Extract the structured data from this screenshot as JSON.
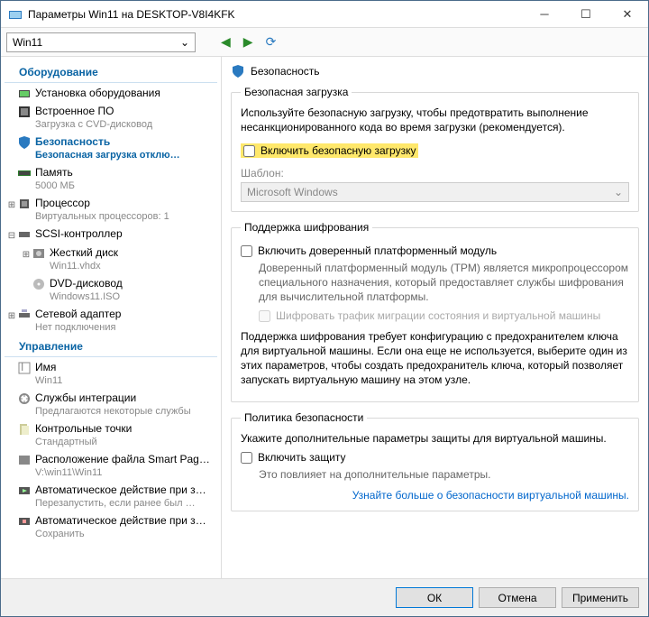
{
  "window": {
    "title": "Параметры Win11 на DESKTOP-V8I4KFK",
    "vm_name": "Win11"
  },
  "sidebar": {
    "cat_hardware": "Оборудование",
    "cat_management": "Управление",
    "items": {
      "add_hw": {
        "label": "Установка оборудования"
      },
      "firmware": {
        "label": "Встроенное ПО",
        "sub": "Загрузка с CVD-дисковод"
      },
      "security": {
        "label": "Безопасность",
        "sub": "Безопасная загрузка отклю…"
      },
      "memory": {
        "label": "Память",
        "sub": "5000 МБ"
      },
      "cpu": {
        "label": "Процессор",
        "sub": "Виртуальных процессоров: 1"
      },
      "scsi": {
        "label": "SCSI-контроллер"
      },
      "hdd": {
        "label": "Жесткий диск",
        "sub": "Win11.vhdx"
      },
      "dvd": {
        "label": "DVD-дисковод",
        "sub": "Windows11.ISO"
      },
      "net": {
        "label": "Сетевой адаптер",
        "sub": "Нет подключения"
      },
      "name": {
        "label": "Имя",
        "sub": "Win11"
      },
      "integ": {
        "label": "Службы интеграции",
        "sub": "Предлагаются некоторые службы"
      },
      "checkpoints": {
        "label": "Контрольные точки",
        "sub": "Стандартный"
      },
      "paging": {
        "label": "Расположение файла Smart Paging",
        "sub": "V:\\win11\\Win11"
      },
      "auto_start": {
        "label": "Автоматическое действие при за…",
        "sub": "Перезапустить, если ранее был …"
      },
      "auto_stop": {
        "label": "Автоматическое действие при за…",
        "sub": "Сохранить"
      }
    }
  },
  "panel": {
    "title": "Безопасность",
    "secure_boot": {
      "legend": "Безопасная загрузка",
      "desc": "Используйте безопасную загрузку, чтобы предотвратить выполнение несанкционированного кода во время загрузки (рекомендуется).",
      "enable": "Включить безопасную загрузку",
      "template_label": "Шаблон:",
      "template_value": "Microsoft Windows"
    },
    "encryption": {
      "legend": "Поддержка шифрования",
      "tpm": "Включить доверенный платформенный модуль",
      "tpm_desc": "Доверенный платформенный модуль (TPM) является микропроцессором специального назначения, который предоставляет службы шифрования для вычислительной платформы.",
      "encrypt_traffic": "Шифровать трафик миграции состояния и виртуальной машины",
      "guard_desc": "Поддержка шифрования требует конфигурацию с предохранителем ключа для виртуальной машины. Если она еще не используется, выберите один из этих параметров, чтобы создать предохранитель ключа, который позволяет запускать виртуальную машину на этом узле."
    },
    "policy": {
      "legend": "Политика безопасности",
      "desc": "Укажите дополнительные параметры защиты для виртуальной машины.",
      "shield": "Включить защиту",
      "sub": "Это повлияет на дополнительные параметры.",
      "link": "Узнайте больше о безопасности виртуальной машины."
    }
  },
  "buttons": {
    "ok": "ОК",
    "cancel": "Отмена",
    "apply": "Применить"
  }
}
